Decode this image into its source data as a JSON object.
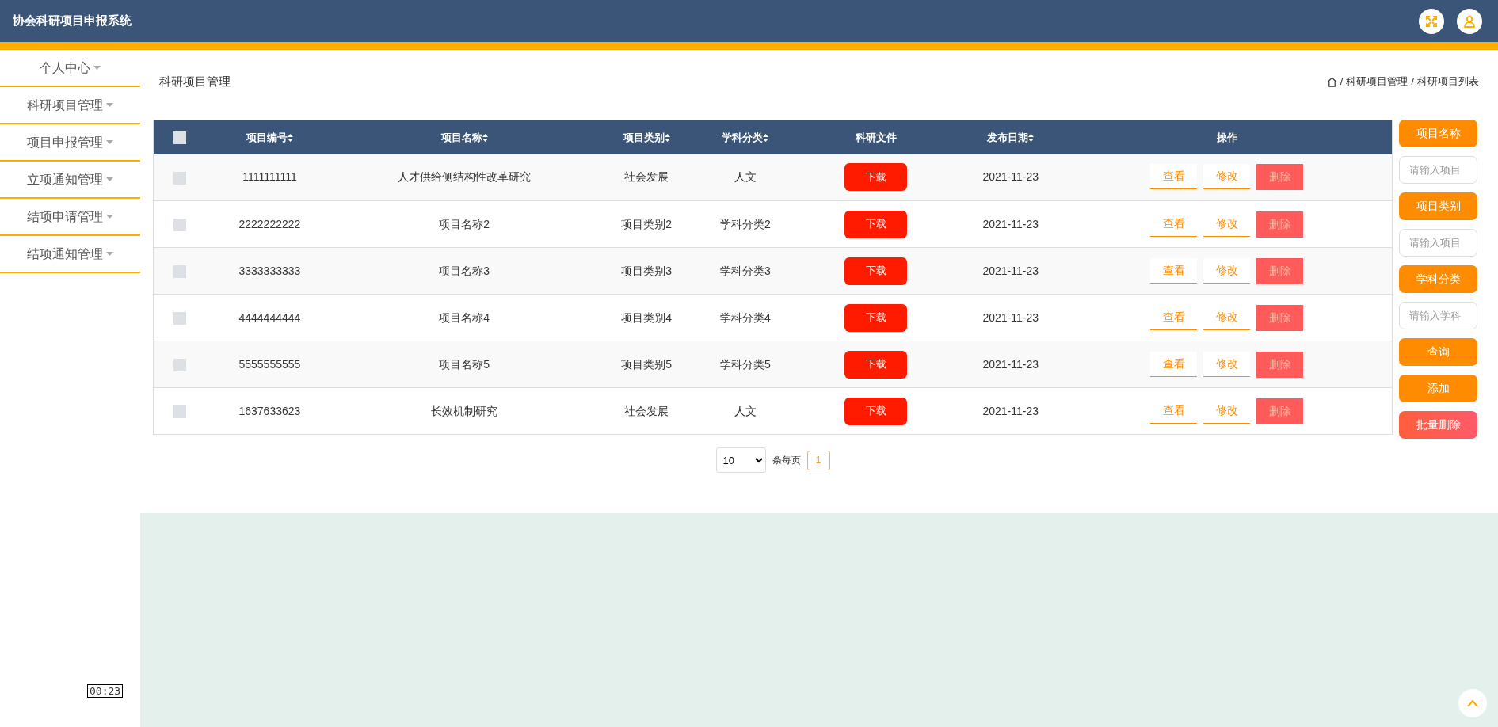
{
  "header": {
    "title": "协会科研项目申报系统"
  },
  "sidebar": {
    "items": [
      {
        "label": "个人中心"
      },
      {
        "label": "科研项目管理"
      },
      {
        "label": "项目申报管理"
      },
      {
        "label": "立项通知管理"
      },
      {
        "label": "结项申请管理"
      },
      {
        "label": "结项通知管理"
      }
    ]
  },
  "page": {
    "title": "科研项目管理",
    "separator": "/",
    "breadcrumb": [
      "科研项目管理",
      "科研项目列表"
    ]
  },
  "table": {
    "select_all": {
      "checked": false
    },
    "columns": [
      {
        "label": "项目编号",
        "sortable": true
      },
      {
        "label": "项目名称",
        "sortable": true
      },
      {
        "label": "项目类别",
        "sortable": true
      },
      {
        "label": "学科分类",
        "sortable": true
      },
      {
        "label": "科研文件",
        "sortable": false
      },
      {
        "label": "发布日期",
        "sortable": true
      },
      {
        "label": "操作",
        "sortable": false
      }
    ],
    "rows": [
      {
        "checked": false,
        "cells": [
          "1111111111",
          "人才供给侧结构性改革研究",
          "社会发展",
          "人文"
        ],
        "download": "下载",
        "date": "2021-11-23",
        "actions": [
          "查看",
          "修改",
          "删除"
        ]
      },
      {
        "checked": false,
        "cells": [
          "2222222222",
          "项目名称2",
          "项目类别2",
          "学科分类2"
        ],
        "download": "下载",
        "date": "2021-11-23",
        "actions": [
          "查看",
          "修改",
          "删除"
        ]
      },
      {
        "checked": false,
        "cells": [
          "3333333333",
          "项目名称3",
          "项目类别3",
          "学科分类3"
        ],
        "download": "下载",
        "date": "2021-11-23",
        "actions": [
          "查看",
          "修改",
          "删除"
        ]
      },
      {
        "checked": false,
        "cells": [
          "4444444444",
          "项目名称4",
          "项目类别4",
          "学科分类4"
        ],
        "download": "下载",
        "date": "2021-11-23",
        "actions": [
          "查看",
          "修改",
          "删除"
        ]
      },
      {
        "checked": false,
        "cells": [
          "5555555555",
          "项目名称5",
          "项目类别5",
          "学科分类5"
        ],
        "download": "下载",
        "date": "2021-11-23",
        "actions": [
          "查看",
          "修改",
          "删除"
        ]
      },
      {
        "checked": false,
        "cells": [
          "1637633623",
          "长效机制研究",
          "社会发展",
          "人文"
        ],
        "download": "下载",
        "date": "2021-11-23",
        "actions": [
          "查看",
          "修改",
          "删除"
        ]
      }
    ]
  },
  "search": {
    "filters": [
      {
        "label": "项目名称",
        "placeholder": "请输入项目"
      },
      {
        "label": "项目类别",
        "placeholder": "请输入项目"
      },
      {
        "label": "学科分类",
        "placeholder": "请输入学科"
      }
    ],
    "buttons": [
      {
        "label": "查询",
        "kind": "primary"
      },
      {
        "label": "添加",
        "kind": "primary"
      },
      {
        "label": "批量删除",
        "kind": "danger"
      }
    ]
  },
  "pagination": {
    "page_size": "10",
    "per_page_label": "条每页",
    "pages": [
      {
        "label": "1",
        "selected": true
      }
    ]
  },
  "tooltip": "00:23"
}
